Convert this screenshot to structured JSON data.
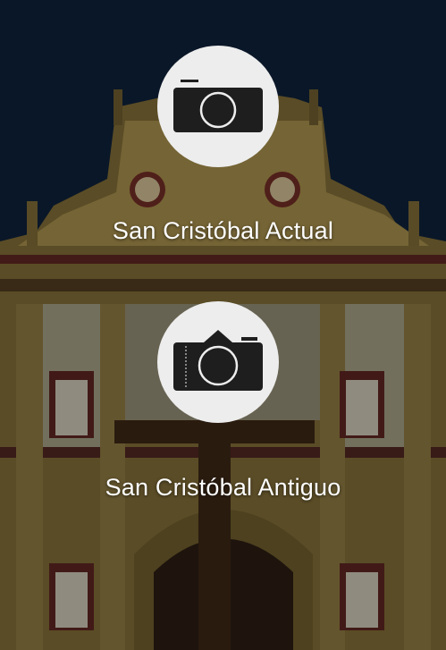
{
  "options": [
    {
      "label": "San Cristóbal Actual",
      "icon": "camera-compact-icon"
    },
    {
      "label": "San Cristóbal Antiguo",
      "icon": "camera-slr-icon"
    }
  ],
  "colors": {
    "sky": "#0f2038",
    "facade": "#b39a52",
    "trim": "#6b2a24",
    "circle": "#ededed",
    "icon": "#1e1e1e",
    "text": "#ffffff"
  }
}
